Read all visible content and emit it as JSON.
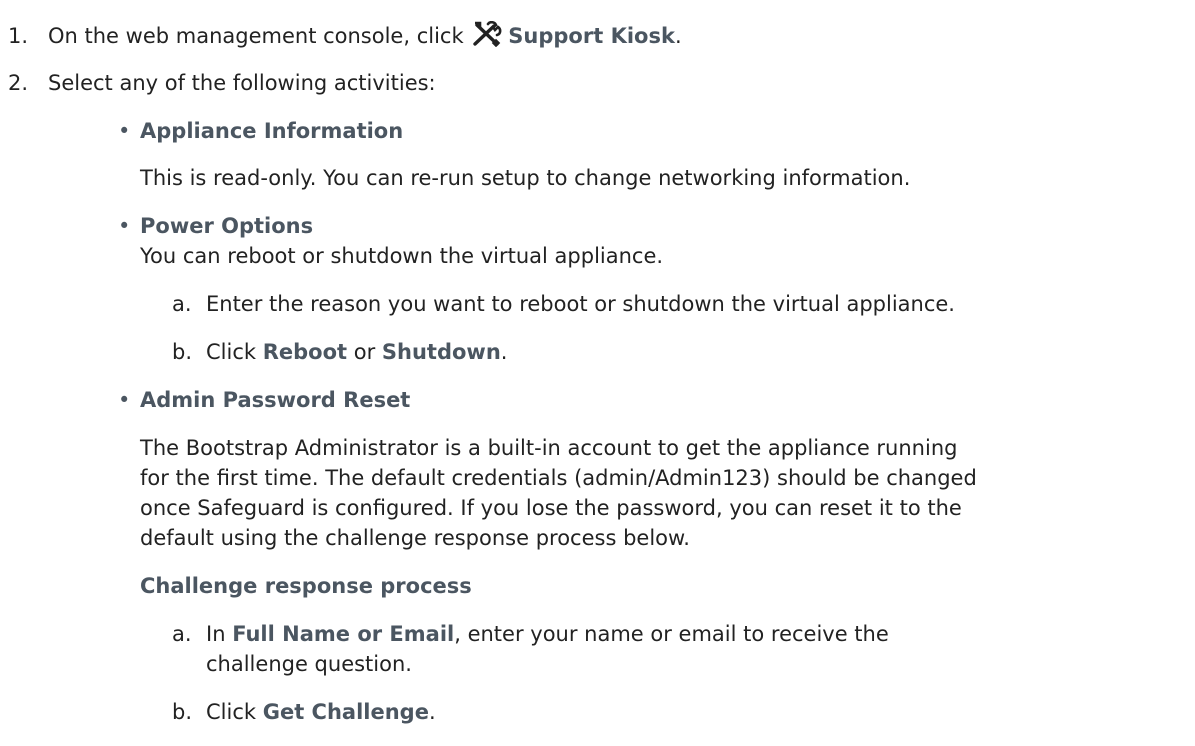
{
  "steps": {
    "s1": {
      "number": "1.",
      "text_before": "On the web management console, click ",
      "icon": "tools-icon",
      "bold": "Support Kiosk",
      "text_after": "."
    },
    "s2": {
      "number": "2.",
      "text": "Select any of the following activities:"
    }
  },
  "activities": {
    "appliance": {
      "bullet": "•",
      "title": "Appliance Information",
      "description": "This is read-only. You can re-run setup to change networking information."
    },
    "power": {
      "bullet": "•",
      "title": "Power Options",
      "description": "You can reboot or shutdown the virtual appliance.",
      "sub_a": {
        "marker": "a.",
        "text": "Enter the reason you want to reboot or shutdown the virtual appliance."
      },
      "sub_b": {
        "marker": "b.",
        "text_before": "Click ",
        "bold1": "Reboot",
        "text_mid": " or ",
        "bold2": "Shutdown",
        "text_after": "."
      }
    },
    "admin": {
      "bullet": "•",
      "title": "Admin Password Reset",
      "para_lines": [
        "The Bootstrap Administrator is a built-in account to get the appliance running",
        "for the first time. The default credentials (admin/Admin123) should be changed",
        "once Safeguard is configured. If you lose the password, you can reset it to the",
        "default using the challenge response process below."
      ],
      "process_heading": "Challenge response process",
      "sub_a": {
        "marker": "a.",
        "text_before": "In ",
        "bold": "Full Name or Email",
        "text_after": ", enter your name or email to receive the",
        "continuation": "challenge question."
      },
      "sub_b": {
        "marker": "b.",
        "text_before": "Click ",
        "bold": "Get Challenge",
        "text_after": "."
      }
    }
  },
  "colors": {
    "text": "#222222",
    "bold": "#4b5661",
    "icon": "#222222"
  }
}
